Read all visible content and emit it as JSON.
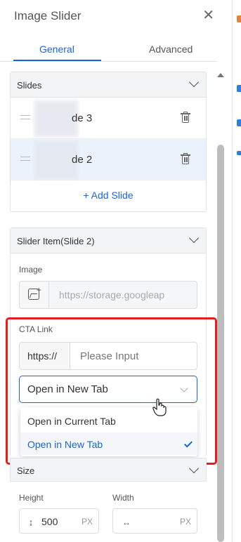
{
  "header": {
    "title": "Image Slider",
    "close_glyph": "✕"
  },
  "tabs": [
    {
      "label": "General",
      "active": true
    },
    {
      "label": "Advanced",
      "active": false
    }
  ],
  "slides": {
    "title": "Slides",
    "items": [
      {
        "label": "de 3",
        "active": false
      },
      {
        "label": "de 2",
        "active": true
      }
    ],
    "add_label": "+ Add Slide"
  },
  "slider_item": {
    "title": "Slider Item(Slide 2)",
    "image_label": "Image",
    "image_url": "https://storage.googleap",
    "cta_label": "CTA Link",
    "url_prefix": "https://",
    "url_placeholder": "Please Input",
    "target_select": {
      "value": "Open in New Tab",
      "options": [
        "Open in Current Tab",
        "Open in New Tab"
      ],
      "selected": "Open in New Tab"
    }
  },
  "size": {
    "title": "Size",
    "height_label": "Height",
    "height_value": "500",
    "height_unit": "PX",
    "width_label": "Width",
    "width_value": "",
    "width_unit": "PX"
  },
  "colors": {
    "accent": "#1a66d1",
    "highlight_box": "#e02020",
    "active_row": "#eaf2fc"
  }
}
